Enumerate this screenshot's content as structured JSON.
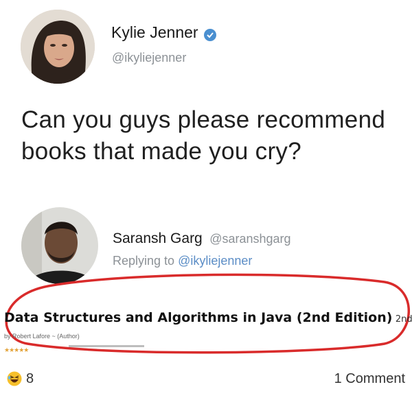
{
  "tweet": {
    "author_name": "Kylie Jenner",
    "author_handle": "@ikyliejenner",
    "text_line1": "Can you guys please recommend",
    "text_line2": "books that made you cry?"
  },
  "reply": {
    "author_name": "Saransh Garg",
    "author_handle": "@saranshgarg",
    "replying_prefix": "Replying to",
    "replying_handle": "@ikyliejenner",
    "book_title": "Data Structures and Algorithms in Java (2nd Edition)",
    "book_edition": "2nd",
    "byline": "by Robert Lafore ~ (Author)"
  },
  "footer": {
    "reaction_count": "8",
    "comment_count": "1 Comment"
  },
  "colors": {
    "verified_badge": "#4a8fd0",
    "link": "#5b8dc6",
    "circle_annotation": "#d92b2b",
    "rating_stars": "#e3a33a"
  },
  "icons": [
    "verified-badge-icon",
    "laughing-emoji-icon",
    "star-icon"
  ]
}
